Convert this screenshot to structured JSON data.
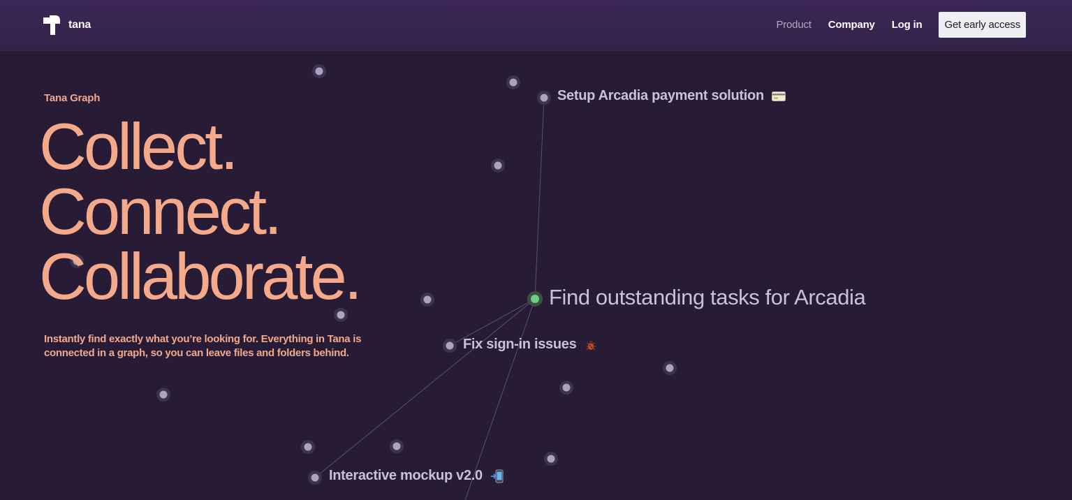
{
  "brand": {
    "name": "tana"
  },
  "nav": {
    "links": [
      {
        "label": "Product",
        "active": true
      },
      {
        "label": "Company",
        "active": false
      },
      {
        "label": "Log in",
        "active": false
      }
    ],
    "cta_label": "Get early access"
  },
  "hero": {
    "eyebrow": "Tana Graph",
    "headline": [
      "Collect.",
      "Connect.",
      "Collaborate."
    ],
    "description": "Instantly find exactly what you’re looking for. Everything in Tana is connected in a graph, so you can leave files and folders behind."
  },
  "graph": {
    "labels": {
      "setup": "Setup Arcadia payment solution",
      "find": "Find outstanding tasks for Arcadia",
      "fix": "Fix sign-in issues",
      "mockup": "Interactive mockup v2.0"
    }
  },
  "colors": {
    "background": "#271b36",
    "nav_background": "#3c2756",
    "accent": "#f4a98b",
    "node_fill": "#a9a6bc",
    "node_active": "#6fcf84",
    "node_label": "#c7c2d5"
  },
  "icons": {
    "card": "credit-card-icon",
    "bug": "bug-icon",
    "mockup": "mobile-arrow-icon"
  }
}
